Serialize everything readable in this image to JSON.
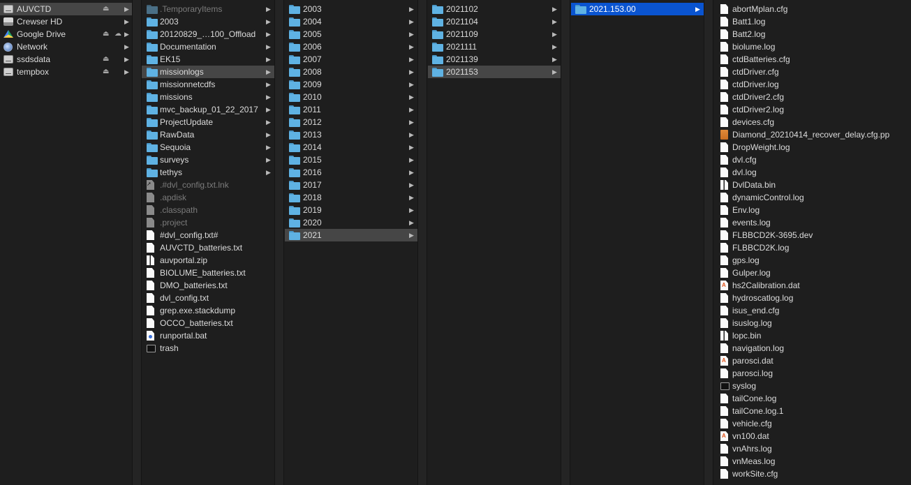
{
  "sidebar": {
    "items": [
      {
        "label": "AUVCTD",
        "icon": "external-drive-icon",
        "eject": true,
        "selected": true
      },
      {
        "label": "Crewser HD",
        "icon": "hard-drive-icon",
        "eject": false
      },
      {
        "label": "Google Drive",
        "icon": "google-drive-icon",
        "eject": true,
        "cloud": true
      },
      {
        "label": "Network",
        "icon": "network-globe-icon",
        "eject": false
      },
      {
        "label": "ssdsdata",
        "icon": "external-drive-icon",
        "eject": true
      },
      {
        "label": "tempbox",
        "icon": "external-drive-icon",
        "eject": true
      }
    ]
  },
  "column1": {
    "items": [
      {
        "label": ".TemporaryItems",
        "type": "folder",
        "dim": true,
        "chevron": true
      },
      {
        "label": "2003",
        "type": "folder",
        "chevron": true
      },
      {
        "label": "20120829_…100_Offload",
        "type": "folder",
        "chevron": true
      },
      {
        "label": "Documentation",
        "type": "folder",
        "chevron": true
      },
      {
        "label": "EK15",
        "type": "folder",
        "chevron": true
      },
      {
        "label": "missionlogs",
        "type": "folder",
        "chevron": true,
        "selected": true
      },
      {
        "label": "missionnetcdfs",
        "type": "folder",
        "chevron": true
      },
      {
        "label": "missions",
        "type": "folder",
        "chevron": true
      },
      {
        "label": "mvc_backup_01_22_2017",
        "type": "folder",
        "chevron": true
      },
      {
        "label": "ProjectUpdate",
        "type": "folder",
        "chevron": true
      },
      {
        "label": "RawData",
        "type": "folder",
        "chevron": true
      },
      {
        "label": "Sequoia",
        "type": "folder",
        "chevron": true
      },
      {
        "label": "surveys",
        "type": "folder",
        "chevron": true
      },
      {
        "label": "tethys",
        "type": "folder",
        "chevron": true
      },
      {
        "label": ".#dvl_config.txt.lnk",
        "type": "alias",
        "dim": true
      },
      {
        "label": ".apdisk",
        "type": "doc",
        "dim": true
      },
      {
        "label": ".classpath",
        "type": "doc",
        "dim": true
      },
      {
        "label": ".project",
        "type": "doc",
        "dim": true
      },
      {
        "label": "#dvl_config.txt#",
        "type": "doc"
      },
      {
        "label": "AUVCTD_batteries.txt",
        "type": "doc"
      },
      {
        "label": "auvportal.zip",
        "type": "zip"
      },
      {
        "label": "BIOLUME_batteries.txt",
        "type": "doc"
      },
      {
        "label": "DMO_batteries.txt",
        "type": "doc"
      },
      {
        "label": "dvl_config.txt",
        "type": "doc"
      },
      {
        "label": "grep.exe.stackdump",
        "type": "doc"
      },
      {
        "label": "OCCO_batteries.txt",
        "type": "doc"
      },
      {
        "label": "runportal.bat",
        "type": "bat"
      },
      {
        "label": "trash",
        "type": "term"
      }
    ]
  },
  "column2": {
    "items": [
      {
        "label": "2003",
        "type": "folder",
        "chevron": true
      },
      {
        "label": "2004",
        "type": "folder",
        "chevron": true
      },
      {
        "label": "2005",
        "type": "folder",
        "chevron": true
      },
      {
        "label": "2006",
        "type": "folder",
        "chevron": true
      },
      {
        "label": "2007",
        "type": "folder",
        "chevron": true
      },
      {
        "label": "2008",
        "type": "folder",
        "chevron": true
      },
      {
        "label": "2009",
        "type": "folder",
        "chevron": true
      },
      {
        "label": "2010",
        "type": "folder",
        "chevron": true
      },
      {
        "label": "2011",
        "type": "folder",
        "chevron": true
      },
      {
        "label": "2012",
        "type": "folder",
        "chevron": true
      },
      {
        "label": "2013",
        "type": "folder",
        "chevron": true
      },
      {
        "label": "2014",
        "type": "folder",
        "chevron": true
      },
      {
        "label": "2015",
        "type": "folder",
        "chevron": true
      },
      {
        "label": "2016",
        "type": "folder",
        "chevron": true
      },
      {
        "label": "2017",
        "type": "folder",
        "chevron": true
      },
      {
        "label": "2018",
        "type": "folder",
        "chevron": true
      },
      {
        "label": "2019",
        "type": "folder",
        "chevron": true
      },
      {
        "label": "2020",
        "type": "folder",
        "chevron": true
      },
      {
        "label": "2021",
        "type": "folder",
        "chevron": true,
        "selected": true
      }
    ]
  },
  "column3": {
    "items": [
      {
        "label": "2021102",
        "type": "folder",
        "chevron": true
      },
      {
        "label": "2021104",
        "type": "folder",
        "chevron": true
      },
      {
        "label": "2021109",
        "type": "folder",
        "chevron": true
      },
      {
        "label": "2021111",
        "type": "folder",
        "chevron": true
      },
      {
        "label": "2021139",
        "type": "folder",
        "chevron": true
      },
      {
        "label": "2021153",
        "type": "folder",
        "chevron": true,
        "selected": true
      }
    ]
  },
  "column4": {
    "items": [
      {
        "label": "2021.153.00",
        "type": "folder",
        "chevron": true,
        "selected": true,
        "active": true
      }
    ]
  },
  "column5": {
    "items": [
      {
        "label": "abortMplan.cfg",
        "type": "doc"
      },
      {
        "label": "Batt1.log",
        "type": "doc"
      },
      {
        "label": "Batt2.log",
        "type": "doc"
      },
      {
        "label": "biolume.log",
        "type": "doc"
      },
      {
        "label": "ctdBatteries.cfg",
        "type": "doc"
      },
      {
        "label": "ctdDriver.cfg",
        "type": "doc"
      },
      {
        "label": "ctdDriver.log",
        "type": "doc"
      },
      {
        "label": "ctdDriver2.cfg",
        "type": "doc"
      },
      {
        "label": "ctdDriver2.log",
        "type": "doc"
      },
      {
        "label": "devices.cfg",
        "type": "doc"
      },
      {
        "label": "Diamond_20210414_recover_delay.cfg.pp",
        "type": "pp"
      },
      {
        "label": "DropWeight.log",
        "type": "doc"
      },
      {
        "label": "dvl.cfg",
        "type": "doc"
      },
      {
        "label": "dvl.log",
        "type": "doc"
      },
      {
        "label": "DvlData.bin",
        "type": "zip"
      },
      {
        "label": "dynamicControl.log",
        "type": "doc"
      },
      {
        "label": "Env.log",
        "type": "doc"
      },
      {
        "label": "events.log",
        "type": "doc"
      },
      {
        "label": "FLBBCD2K-3695.dev",
        "type": "doc"
      },
      {
        "label": "FLBBCD2K.log",
        "type": "doc"
      },
      {
        "label": "gps.log",
        "type": "doc"
      },
      {
        "label": "Gulper.log",
        "type": "doc"
      },
      {
        "label": "hs2Calibration.dat",
        "type": "dat"
      },
      {
        "label": "hydroscatlog.log",
        "type": "doc"
      },
      {
        "label": "isus_end.cfg",
        "type": "doc"
      },
      {
        "label": "isuslog.log",
        "type": "doc"
      },
      {
        "label": "lopc.bin",
        "type": "zip"
      },
      {
        "label": "navigation.log",
        "type": "doc"
      },
      {
        "label": "parosci.dat",
        "type": "dat"
      },
      {
        "label": "parosci.log",
        "type": "doc"
      },
      {
        "label": "syslog",
        "type": "term"
      },
      {
        "label": "tailCone.log",
        "type": "doc"
      },
      {
        "label": "tailCone.log.1",
        "type": "doc"
      },
      {
        "label": "vehicle.cfg",
        "type": "doc"
      },
      {
        "label": "vn100.dat",
        "type": "dat"
      },
      {
        "label": "vnAhrs.log",
        "type": "doc"
      },
      {
        "label": "vnMeas.log",
        "type": "doc"
      },
      {
        "label": "workSite.cfg",
        "type": "doc"
      }
    ]
  },
  "colors": {
    "background": "#1e1e1e",
    "selection_active": "#0a54d0",
    "selection_inactive": "#464646",
    "folder": "#5fb2e3",
    "text": "#dcdcdc",
    "text_dim": "#7b7b7b"
  }
}
